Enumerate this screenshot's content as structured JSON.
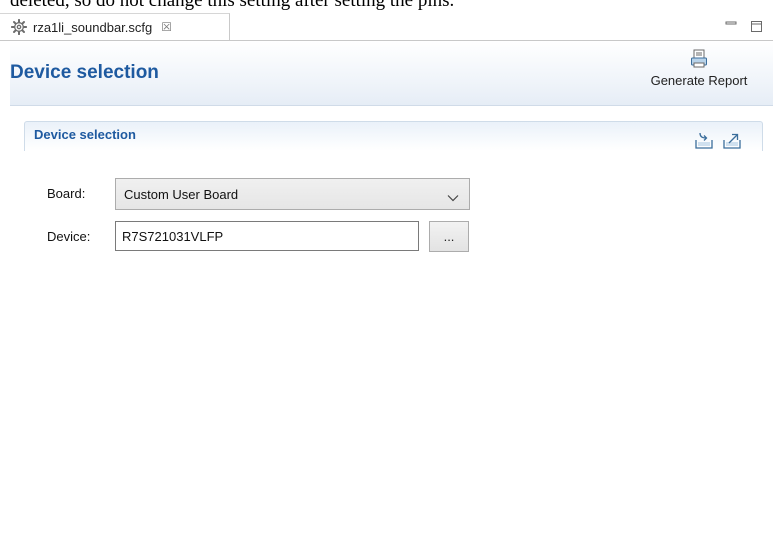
{
  "document_text": "deleted, so do not change this setting after setting the pins.",
  "editor_tab": {
    "icon": "gear-icon",
    "label": "rza1li_soundbar.scfg",
    "close_glyph": "☒"
  },
  "window_controls": {
    "minimize_icon": "minimize-icon",
    "maximize_icon": "maximize-icon"
  },
  "form": {
    "title": "Device selection",
    "generate_report": {
      "icon": "report-icon",
      "label": "Generate Report"
    }
  },
  "section": {
    "title": "Device selection",
    "icons": [
      "import-icon",
      "export-icon"
    ],
    "board": {
      "label": "Board:",
      "selected": "Custom User Board"
    },
    "device": {
      "label": "Device:",
      "value": "R7S721031VLFP",
      "browse_label": "..."
    }
  },
  "colors": {
    "title_blue": "#1e5aa0",
    "header_gradient_end": "#e6edf6"
  }
}
